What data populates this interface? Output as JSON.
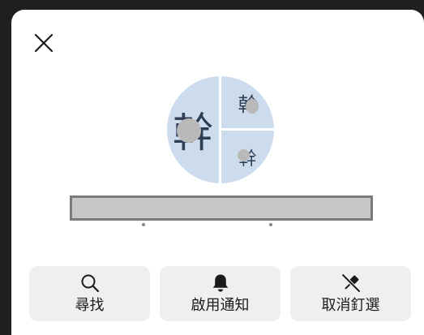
{
  "avatar": {
    "glyph_large": "幹",
    "glyph_small_top": "幹",
    "glyph_small_bottom": "幹"
  },
  "actions": [
    {
      "label": "尋找",
      "icon": "search-icon"
    },
    {
      "label": "啟用通知",
      "icon": "bell-icon"
    },
    {
      "label": "取消釘選",
      "icon": "unpin-icon"
    }
  ],
  "colors": {
    "sheet": "#ffffff",
    "backdrop": "#1f1f1f",
    "action_bg": "#efefef",
    "avatar_tile": "#cddced",
    "redaction": "#c7c7c7"
  }
}
